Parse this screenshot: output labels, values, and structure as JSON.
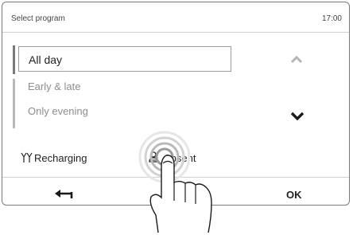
{
  "header": {
    "title": "Select program",
    "time": "17:00"
  },
  "programs": {
    "selected": "All day",
    "items": [
      "Early & late",
      "Only evening"
    ]
  },
  "icons": {
    "scroll_up": "chevron-up-icon",
    "scroll_down": "chevron-down-icon",
    "recharging": "antenna-icon",
    "absent": "person-icon",
    "back": "back-arrow-icon",
    "hand": "touch-hand-icon"
  },
  "modes": {
    "recharging_label": "Recharging",
    "absent_label": "Absent"
  },
  "footer": {
    "ok_label": "OK"
  },
  "colors": {
    "text": "#222222",
    "muted": "#8e8e8e",
    "border": "#9c9c9c",
    "disabled_chevron": "#b5b5b5"
  }
}
